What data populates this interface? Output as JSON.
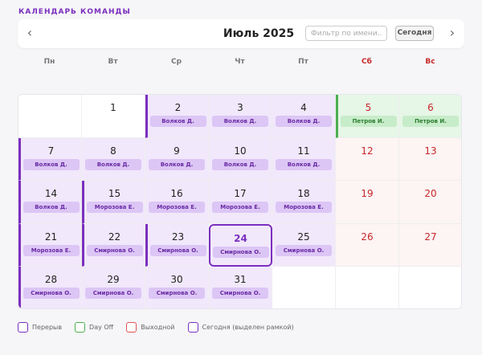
{
  "app_title": "КАЛЕНДАРЬ КОМАНДЫ",
  "header": {
    "month_title": "Июль 2025",
    "filter_placeholder": "Фильтр по имени...",
    "today_label": "Сегодня",
    "prev_icon": "‹",
    "next_icon": "›"
  },
  "weekdays": [
    "Пн",
    "Вт",
    "Ср",
    "Чт",
    "Пт",
    "Сб",
    "Вс"
  ],
  "weekend_color": "#c62828",
  "accent_color": "#7b2fbe",
  "weeks": [
    [
      {
        "day": "",
        "type": "empty"
      },
      {
        "day": "1",
        "type": "empty",
        "chip": ""
      },
      {
        "day": "2",
        "type": "break",
        "chip": "Волков Д.",
        "bar": "purple"
      },
      {
        "day": "3",
        "type": "break",
        "chip": "Волков Д."
      },
      {
        "day": "4",
        "type": "break",
        "chip": "Волков Д."
      },
      {
        "day": "5",
        "type": "dayoff",
        "chip": "Петров И.",
        "bar": "green"
      },
      {
        "day": "6",
        "type": "dayoff",
        "chip": "Петров И."
      }
    ],
    [
      {
        "day": "7",
        "type": "break",
        "chip": "Волков Д.",
        "bar": "purple"
      },
      {
        "day": "8",
        "type": "break",
        "chip": "Волков Д."
      },
      {
        "day": "9",
        "type": "break",
        "chip": "Волков Д."
      },
      {
        "day": "10",
        "type": "break",
        "chip": "Волков Д."
      },
      {
        "day": "11",
        "type": "break",
        "chip": "Волков Д."
      },
      {
        "day": "12",
        "type": "weekend",
        "chip": ""
      },
      {
        "day": "13",
        "type": "weekend",
        "chip": ""
      }
    ],
    [
      {
        "day": "14",
        "type": "break",
        "chip": "Волков Д.",
        "bar": "purple"
      },
      {
        "day": "15",
        "type": "break",
        "chip": "Морозова Е.",
        "bar": "purple"
      },
      {
        "day": "16",
        "type": "break",
        "chip": "Морозова Е."
      },
      {
        "day": "17",
        "type": "break",
        "chip": "Морозова Е."
      },
      {
        "day": "18",
        "type": "break",
        "chip": "Морозова Е."
      },
      {
        "day": "19",
        "type": "weekend",
        "chip": ""
      },
      {
        "day": "20",
        "type": "weekend",
        "chip": ""
      }
    ],
    [
      {
        "day": "21",
        "type": "break",
        "chip": "Морозова Е.",
        "bar": "purple"
      },
      {
        "day": "22",
        "type": "break",
        "chip": "Смирнова О.",
        "bar": "purple"
      },
      {
        "day": "23",
        "type": "break",
        "chip": "Смирнова О.",
        "bar": "purple"
      },
      {
        "day": "24",
        "type": "today",
        "chip": "Смирнова О.",
        "bar": "purple"
      },
      {
        "day": "25",
        "type": "break",
        "chip": "Смирнова О."
      },
      {
        "day": "26",
        "type": "weekend",
        "chip": ""
      },
      {
        "day": "27",
        "type": "weekend",
        "chip": ""
      }
    ],
    [
      {
        "day": "28",
        "type": "break",
        "chip": "Смирнова О.",
        "bar": "purple"
      },
      {
        "day": "29",
        "type": "break",
        "chip": "Смирнова О."
      },
      {
        "day": "30",
        "type": "break",
        "chip": "Смирнова О."
      },
      {
        "day": "31",
        "type": "break",
        "chip": "Смирнова О."
      },
      {
        "day": "",
        "type": "empty"
      },
      {
        "day": "",
        "type": "empty"
      },
      {
        "day": "",
        "type": "empty"
      }
    ]
  ],
  "legend": [
    {
      "label": "Перерыв",
      "color": "#7b2fbe"
    },
    {
      "label": "Day Off",
      "color": "#4caf50"
    },
    {
      "label": "Выходной",
      "color": "#e05353"
    },
    {
      "label": "Сегодня (выделен рамкой)",
      "color": "#7b2fbe"
    }
  ]
}
